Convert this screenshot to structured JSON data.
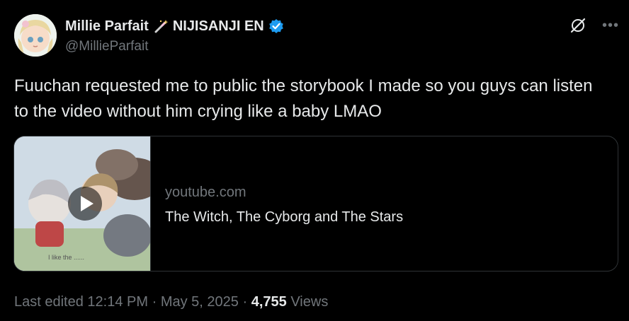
{
  "user": {
    "display_name": "Millie Parfait",
    "affiliation": "NIJISANJI EN",
    "handle": "@MillieParfait"
  },
  "tweet": {
    "text": "Fuuchan requested me to public the storybook I made so you guys can listen to the video without him crying like a baby LMAO"
  },
  "card": {
    "domain": "youtube.com",
    "title": "The Witch, The Cyborg and The Stars",
    "thumb_caption": "I like the ......"
  },
  "footer": {
    "edited_label": "Last edited",
    "time": "12:14 PM",
    "sep1": "·",
    "date": "May 5, 2025",
    "sep2": "·",
    "views_count": "4,755",
    "views_label": "Views"
  },
  "colors": {
    "background": "#000000",
    "text_primary": "#e7e9ea",
    "text_secondary": "#71767b",
    "verified_blue": "#1d9bf0",
    "border": "#2f3336"
  },
  "icons": [
    "magic-wand-icon",
    "verified-badge-icon",
    "grok-icon",
    "more-options-icon",
    "play-icon"
  ]
}
